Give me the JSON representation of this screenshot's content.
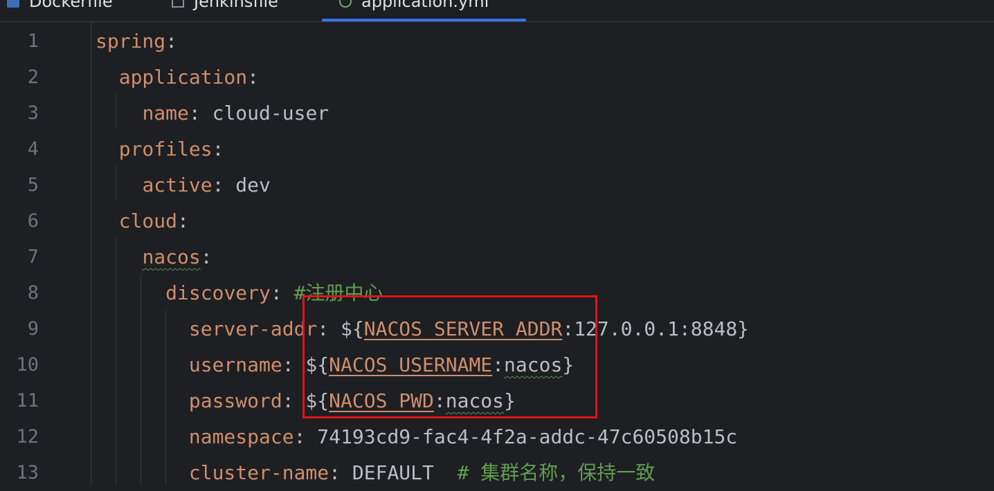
{
  "tabs": [
    {
      "label": "Dockerfile",
      "icon": "docker-file-icon",
      "active": false
    },
    {
      "label": "Jenkinsfile",
      "icon": "text-file-icon",
      "active": false
    },
    {
      "label": "application.yml",
      "icon": "yaml-file-icon",
      "active": true
    }
  ],
  "colors": {
    "background": "#1e1f22",
    "key": "#cf8e6d",
    "text": "#bcbec4",
    "comment": "#5f9e50",
    "line_number": "#6f737a",
    "active_tab_underline": "#3574f0",
    "highlight_box": "#e0141a"
  },
  "lines": [
    {
      "num": "1",
      "parts": [
        {
          "t": "spring",
          "c": "key"
        },
        {
          "t": ":",
          "c": "punc"
        }
      ]
    },
    {
      "num": "2",
      "parts": [
        {
          "t": "  "
        },
        {
          "t": "application",
          "c": "key"
        },
        {
          "t": ":",
          "c": "punc"
        }
      ]
    },
    {
      "num": "3",
      "parts": [
        {
          "t": "    "
        },
        {
          "t": "name",
          "c": "key"
        },
        {
          "t": ": cloud-user",
          "c": "val"
        }
      ]
    },
    {
      "num": "4",
      "parts": [
        {
          "t": "  "
        },
        {
          "t": "profiles",
          "c": "key"
        },
        {
          "t": ":",
          "c": "punc"
        }
      ]
    },
    {
      "num": "5",
      "parts": [
        {
          "t": "    "
        },
        {
          "t": "active",
          "c": "key"
        },
        {
          "t": ": dev",
          "c": "val"
        }
      ]
    },
    {
      "num": "6",
      "parts": [
        {
          "t": "  "
        },
        {
          "t": "cloud",
          "c": "key"
        },
        {
          "t": ":",
          "c": "punc"
        }
      ]
    },
    {
      "num": "7",
      "parts": [
        {
          "t": "    "
        },
        {
          "t": "nacos",
          "c": "key wavy"
        },
        {
          "t": ":",
          "c": "punc"
        }
      ]
    },
    {
      "num": "8",
      "parts": [
        {
          "t": "      "
        },
        {
          "t": "discovery",
          "c": "key"
        },
        {
          "t": ": ",
          "c": "punc"
        },
        {
          "t": "#注册中心",
          "c": "cmt"
        }
      ]
    },
    {
      "num": "9",
      "parts": [
        {
          "t": "        "
        },
        {
          "t": "server-addr",
          "c": "key"
        },
        {
          "t": ": ${",
          "c": "val"
        },
        {
          "t": "NACOS_SERVER_ADDR",
          "c": "var"
        },
        {
          "t": ":127.0.0.1:8848}",
          "c": "val"
        }
      ]
    },
    {
      "num": "10",
      "parts": [
        {
          "t": "        "
        },
        {
          "t": "username",
          "c": "key"
        },
        {
          "t": ": ${",
          "c": "val"
        },
        {
          "t": "NACOS_USERNAME",
          "c": "var"
        },
        {
          "t": ":",
          "c": "val"
        },
        {
          "t": "nacos",
          "c": "val wavy"
        },
        {
          "t": "}",
          "c": "val"
        }
      ]
    },
    {
      "num": "11",
      "parts": [
        {
          "t": "        "
        },
        {
          "t": "password",
          "c": "key"
        },
        {
          "t": ": ${",
          "c": "val"
        },
        {
          "t": "NACOS_PWD",
          "c": "var"
        },
        {
          "t": ":",
          "c": "val"
        },
        {
          "t": "nacos",
          "c": "val wavy"
        },
        {
          "t": "}",
          "c": "val"
        }
      ]
    },
    {
      "num": "12",
      "parts": [
        {
          "t": "        "
        },
        {
          "t": "namespace",
          "c": "key"
        },
        {
          "t": ": 74193cd9-fac4-4f2a-addc-47c60508b15c",
          "c": "val"
        }
      ]
    },
    {
      "num": "13",
      "parts": [
        {
          "t": "        "
        },
        {
          "t": "cluster-name",
          "c": "key"
        },
        {
          "t": ": DEFAULT  ",
          "c": "val"
        },
        {
          "t": "# 集群名称，保持一致",
          "c": "cmt"
        }
      ]
    }
  ]
}
